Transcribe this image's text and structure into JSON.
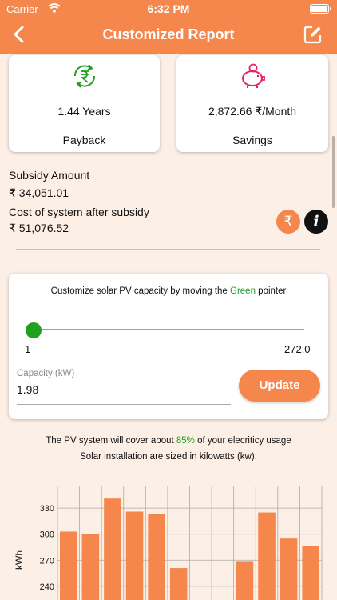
{
  "status": {
    "carrier": "Carrier",
    "time": "6:32 PM"
  },
  "nav": {
    "title": "Customized Report",
    "icons": {
      "back": "chevron-left-icon",
      "edit": "edit-icon"
    }
  },
  "kpis": [
    {
      "value": "1.44 Years",
      "label": "Payback",
      "icon": "rupee-refresh-icon",
      "color": "#1fa01f"
    },
    {
      "value": "2,872.66 ₹/Month",
      "label": "Savings",
      "icon": "piggy-bank-icon",
      "color": "#e0245e"
    }
  ],
  "subsidy": {
    "amount_label": "Subsidy Amount",
    "amount_value": "₹ 34,051.01",
    "cost_label": "Cost of system after subsidy",
    "cost_value": "₹ 51,076.52",
    "rupee_button": "₹",
    "info_button": "i"
  },
  "capacity": {
    "instruction_prefix": "Customize solar PV capacity by moving the ",
    "instruction_green": "Green",
    "instruction_suffix": " pointer",
    "min": "1",
    "max": "272.0",
    "slider_level": 0.0,
    "field_label": "Capacity (kW)",
    "field_value": "1.98",
    "update_label": "Update"
  },
  "coverage": {
    "prefix": "The PV system will cover about ",
    "percent": "85%",
    "suffix": " of your elecriticy usage",
    "note": "Solar installation are sized in kilowatts (kw)."
  },
  "colors": {
    "accent": "#f5874d",
    "green": "#1fa01f",
    "background": "#fcefe6"
  },
  "chart_data": {
    "type": "bar",
    "ylabel": "kWh",
    "yticks": [
      240,
      270,
      300,
      330
    ],
    "ylim": [
      215,
      355
    ],
    "series": [
      {
        "values": [
          303,
          300,
          341,
          326,
          323,
          261,
          0,
          0,
          269,
          325,
          295,
          286
        ]
      }
    ]
  }
}
